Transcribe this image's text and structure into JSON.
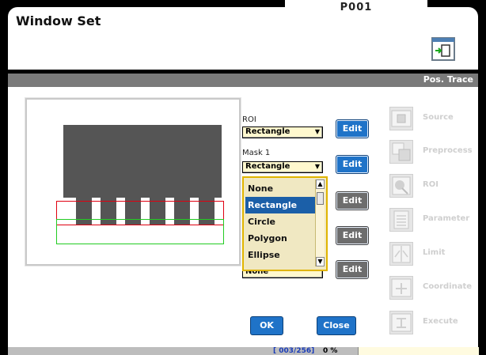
{
  "top_tab": {
    "label": "P001"
  },
  "header": {
    "title": "Window Set",
    "icon": "window-set-icon"
  },
  "section": {
    "label": "Pos. Trace"
  },
  "form": {
    "roi_label": "ROI",
    "roi_value": "Rectangle",
    "mask1_label": "Mask 1",
    "mask1_value": "Rectangle",
    "hidden_value": "None",
    "edit_label": "Edit"
  },
  "dropdown": {
    "options": [
      "None",
      "Rectangle",
      "Circle",
      "Polygon",
      "Ellipse"
    ],
    "selected": "Rectangle"
  },
  "buttons": {
    "ok": "OK",
    "close": "Close"
  },
  "sidebar": {
    "items": [
      {
        "label": "Source",
        "icon": "source-icon"
      },
      {
        "label": "Preprocess",
        "icon": "preprocess-icon"
      },
      {
        "label": "ROI",
        "icon": "roi-icon"
      },
      {
        "label": "Parameter",
        "icon": "parameter-icon"
      },
      {
        "label": "Limit",
        "icon": "limit-icon"
      },
      {
        "label": "Coordinate",
        "icon": "coordinate-icon"
      },
      {
        "label": "Execute",
        "icon": "execute-icon"
      }
    ]
  },
  "status": {
    "counter": "[ 003/256]",
    "percent": "0 %"
  },
  "colors": {
    "accent": "#1f73c8",
    "dropdown_border": "#e0b400",
    "roi_red": "#e00010",
    "roi_green": "#22cc22"
  }
}
